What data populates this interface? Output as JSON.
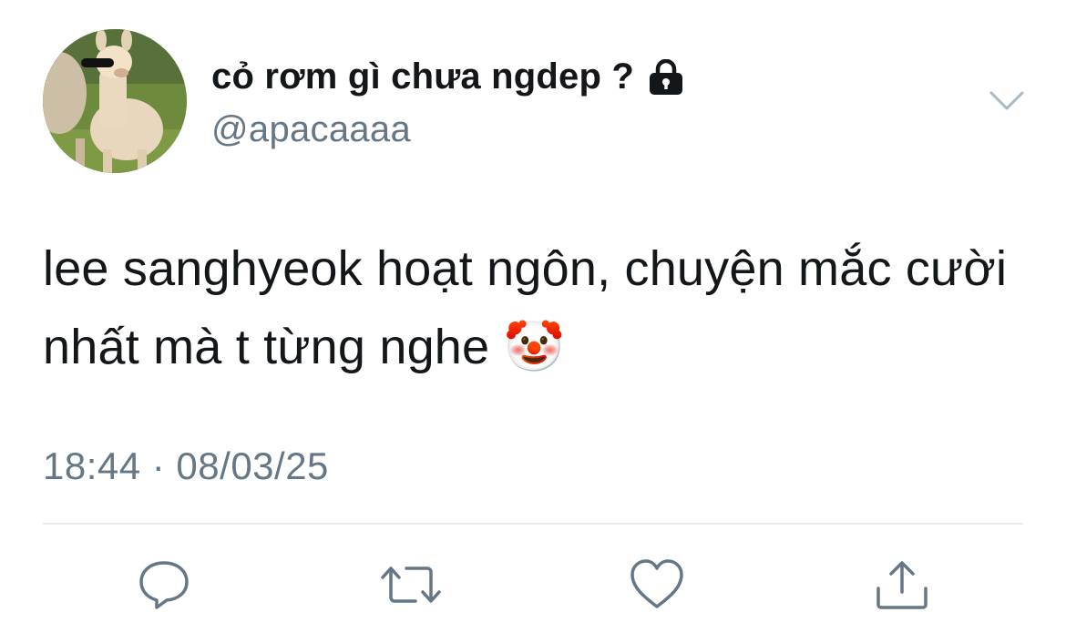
{
  "tweet": {
    "display_name": "cỏ rơm gì chưa ngdep ?",
    "handle": "@apacaaaa",
    "text": "lee sanghyeok hoạt ngôn, chuyện mắc cười nhất mà t từng nghe",
    "emoji": "🤡",
    "timestamp": "18:44 · 08/03/25"
  },
  "icons": {
    "account_status": "lock-icon",
    "menu": "chevron-down-icon",
    "actions": [
      "reply-icon",
      "retweet-icon",
      "like-icon",
      "share-icon"
    ]
  },
  "colors": {
    "text": "#14171a",
    "secondary": "#657786",
    "divider": "#e6ecf0",
    "icon": "#657786"
  }
}
